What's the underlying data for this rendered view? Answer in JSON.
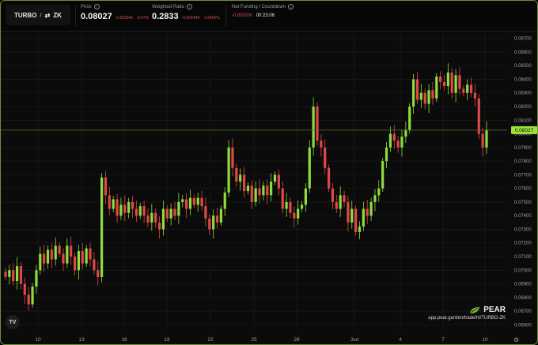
{
  "header": {
    "pair": {
      "base": "TURBO",
      "separator": "/",
      "swap_icon": "⇄",
      "quote": "ZK"
    },
    "price": {
      "label": "Price",
      "value": "0.08027",
      "change": "-0.002541",
      "change_pct": "-3.07%"
    },
    "weighted_ratio": {
      "label": "Weighted Ratio",
      "value": "0.2833",
      "change": "-0.004449",
      "change_pct": "-1.5462%"
    },
    "funding": {
      "label": "Net Funding / Countdown",
      "rate": "-0.0010%",
      "countdown": "00:23:06"
    }
  },
  "branding": {
    "name": "PEAR",
    "url": "app.pear.garden/trade/hl/TURBO-ZK",
    "logo_icon": "leaf-icon",
    "tv_label": "TV"
  },
  "settings_icon": "gear-icon",
  "colors": {
    "up": "#8fdc3c",
    "down": "#e04848",
    "accent": "#9be33b",
    "bg": "#0b0b0b",
    "grid": "#1e1e1e",
    "axis_text": "#a0a0a0"
  },
  "chart_data": {
    "type": "candlestick",
    "x_labels": [
      "10",
      "13",
      "16",
      "19",
      "22",
      "25",
      "28",
      "Jun",
      "4",
      "7",
      "10"
    ],
    "y_ticks": [
      "0.08700",
      "0.08600",
      "0.08500",
      "0.08400",
      "0.08300",
      "0.08200",
      "0.08100",
      "0.08000",
      "0.07900",
      "0.07800",
      "0.07700",
      "0.07600",
      "0.07500",
      "0.07400",
      "0.07300",
      "0.07200",
      "0.07100",
      "0.07000",
      "0.06900",
      "0.06800",
      "0.06700",
      "0.06600"
    ],
    "ylim": [
      0.0655,
      0.0875
    ],
    "current_price": "0.08027",
    "current_price_value": 0.08027,
    "closes": [
      0.0695,
      0.07,
      0.0692,
      0.0703,
      0.069,
      0.0682,
      0.0675,
      0.0688,
      0.07,
      0.0712,
      0.0705,
      0.0715,
      0.0708,
      0.0718,
      0.0712,
      0.0705,
      0.0718,
      0.071,
      0.07,
      0.0714,
      0.0705,
      0.0716,
      0.0708,
      0.07,
      0.0695,
      0.0768,
      0.0755,
      0.0745,
      0.0752,
      0.074,
      0.0748,
      0.0742,
      0.075,
      0.0745,
      0.074,
      0.0747,
      0.074,
      0.0735,
      0.0742,
      0.0735,
      0.073,
      0.0745,
      0.0738,
      0.0745,
      0.074,
      0.075,
      0.0752,
      0.0745,
      0.0753,
      0.0748,
      0.0753,
      0.0747,
      0.0738,
      0.073,
      0.074,
      0.0735,
      0.0745,
      0.0757,
      0.079,
      0.0775,
      0.0765,
      0.077,
      0.0758,
      0.0762,
      0.075,
      0.076,
      0.0755,
      0.0762,
      0.0755,
      0.0765,
      0.077,
      0.076,
      0.0745,
      0.075,
      0.0742,
      0.0738,
      0.0745,
      0.0748,
      0.076,
      0.079,
      0.082,
      0.0795,
      0.079,
      0.0775,
      0.076,
      0.075,
      0.0745,
      0.0755,
      0.075,
      0.0735,
      0.0745,
      0.0728,
      0.0732,
      0.0745,
      0.074,
      0.075,
      0.0755,
      0.076,
      0.078,
      0.079,
      0.08,
      0.0795,
      0.079,
      0.0798,
      0.0803,
      0.082,
      0.084,
      0.0825,
      0.083,
      0.0822,
      0.0832,
      0.0826,
      0.0842,
      0.0838,
      0.0835,
      0.0845,
      0.083,
      0.0843,
      0.0833,
      0.083,
      0.0836,
      0.083,
      0.0826,
      0.08,
      0.079,
      0.0803
    ]
  }
}
